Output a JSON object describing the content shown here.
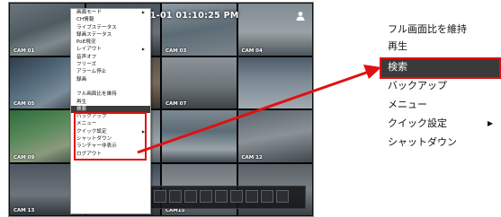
{
  "screen": {
    "datetime": "2015-01-01 01:10:25 PM",
    "cameras": [
      {
        "label": "CAM 01"
      },
      {
        "label": ""
      },
      {
        "label": "CAM 03"
      },
      {
        "label": "CAM 04"
      },
      {
        "label": "CAM 05"
      },
      {
        "label": ""
      },
      {
        "label": "CAM 07"
      },
      {
        "label": ""
      },
      {
        "label": "CAM 09"
      },
      {
        "label": ""
      },
      {
        "label": ""
      },
      {
        "label": "CAM 12"
      },
      {
        "label": "CAM 13"
      },
      {
        "label": ""
      },
      {
        "label": "CAM15"
      },
      {
        "label": ""
      }
    ]
  },
  "context_menu": {
    "items": [
      {
        "label": "画面モード",
        "submenu": true
      },
      {
        "label": "CH情報",
        "submenu": false
      },
      {
        "label": "ライブステータス",
        "submenu": false
      },
      {
        "label": "録画ステータス",
        "submenu": false
      },
      {
        "label": "PoE現況",
        "submenu": false
      },
      {
        "label": "レイアウト",
        "submenu": true
      },
      {
        "label": "音声オフ",
        "submenu": false
      },
      {
        "label": "フリーズ",
        "submenu": false
      },
      {
        "label": "アラーム停止",
        "submenu": false
      },
      {
        "label": "録画",
        "submenu": false
      },
      {
        "label": "",
        "submenu": false
      },
      {
        "label": "フル画面比を維持",
        "submenu": false
      },
      {
        "label": "再生",
        "submenu": false
      },
      {
        "label": "検索",
        "submenu": false,
        "selected": true
      },
      {
        "label": "バックアップ",
        "submenu": false
      },
      {
        "label": "メニュー",
        "submenu": false
      },
      {
        "label": "クイック設定",
        "submenu": true
      },
      {
        "label": "シャットダウン",
        "submenu": false
      },
      {
        "label": "ランチャー非表示",
        "submenu": false
      },
      {
        "label": "ログアウト",
        "submenu": false
      }
    ]
  },
  "zoom_menu": {
    "items": [
      {
        "label": "フル画面比を維持"
      },
      {
        "label": "再生"
      },
      {
        "label": "検索",
        "selected": true
      },
      {
        "label": "バックアップ"
      },
      {
        "label": "メニュー"
      },
      {
        "label": "クイック設定",
        "submenu": true
      },
      {
        "label": "シャットダウン"
      }
    ],
    "submenu_glyph": "▶"
  },
  "colors": {
    "highlight_border": "#e01010",
    "selected_bg": "#3a3a3a",
    "arrow": "#e01010"
  },
  "icons": {
    "user": "user-icon",
    "arrow": "red-arrow"
  }
}
